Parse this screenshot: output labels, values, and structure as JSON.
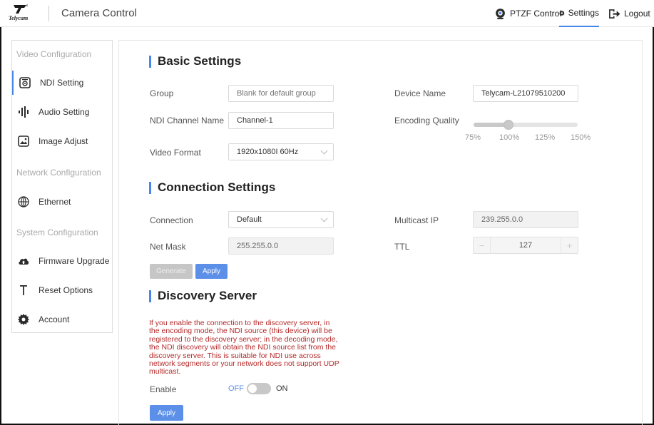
{
  "header": {
    "brand": "Telycam",
    "app_title": "Camera Control",
    "nav": [
      {
        "label": "PTZF Control",
        "icon": "camera-pin-icon"
      },
      {
        "label": "Settings",
        "icon": "gear-icon",
        "active": true
      },
      {
        "label": "Logout",
        "icon": "logout-icon"
      }
    ]
  },
  "sidebar": {
    "sections": [
      {
        "title": "Video Configuration",
        "items": [
          {
            "label": "NDI Setting",
            "icon": "ndi-icon",
            "active": true
          },
          {
            "label": "Audio Setting",
            "icon": "audio-bars-icon"
          },
          {
            "label": "Image Adjust",
            "icon": "image-icon"
          }
        ]
      },
      {
        "title": "Network Configuration",
        "items": [
          {
            "label": "Ethernet",
            "icon": "globe-icon"
          }
        ]
      },
      {
        "title": "System Configuration",
        "items": [
          {
            "label": "Firmware Upgrade",
            "icon": "cloud-upload-icon"
          },
          {
            "label": "Reset Options",
            "icon": "reset-icon"
          },
          {
            "label": "Account",
            "icon": "gear-icon"
          }
        ]
      }
    ]
  },
  "basic": {
    "title": "Basic Settings",
    "group_label": "Group",
    "group_value": "",
    "group_placeholder": "Blank for default group",
    "device_name_label": "Device Name",
    "device_name_value": "Telycam-L21079510200",
    "ndi_channel_label": "NDI Channel Name",
    "ndi_channel_value": "Channel-1",
    "encoding_quality_label": "Encoding Quality",
    "encoding_quality_value": "100%",
    "encoding_quality_ticks": [
      "75%",
      "100%",
      "125%",
      "150%"
    ],
    "video_format_label": "Video Format",
    "video_format_value": "1920x1080I 60Hz"
  },
  "connection": {
    "title": "Connection Settings",
    "connection_label": "Connection",
    "connection_value": "Default",
    "multicast_label": "Multicast IP",
    "multicast_value": "239.255.0.0",
    "netmask_label": "Net Mask",
    "netmask_value": "255.255.0.0",
    "ttl_label": "TTL",
    "ttl_value": "127",
    "generate_label": "Generate",
    "apply_label": "Apply"
  },
  "discovery": {
    "title": "Discovery Server",
    "warning": "If you enable the connection to the discovery server, in the encoding mode, the NDI source (this device) will be registered to the discovery server; in the decoding mode, the NDI discovery will obtain the NDI source list from the discovery server. This is suitable for NDI use across network segments or your network does not support UDP multicast.",
    "enable_label": "Enable",
    "off_label": "OFF",
    "on_label": "ON",
    "enabled": false,
    "apply_label": "Apply"
  },
  "colors": {
    "accent": "#4a86e8",
    "button": "#5b8fe8",
    "warning": "#b52a2a"
  }
}
